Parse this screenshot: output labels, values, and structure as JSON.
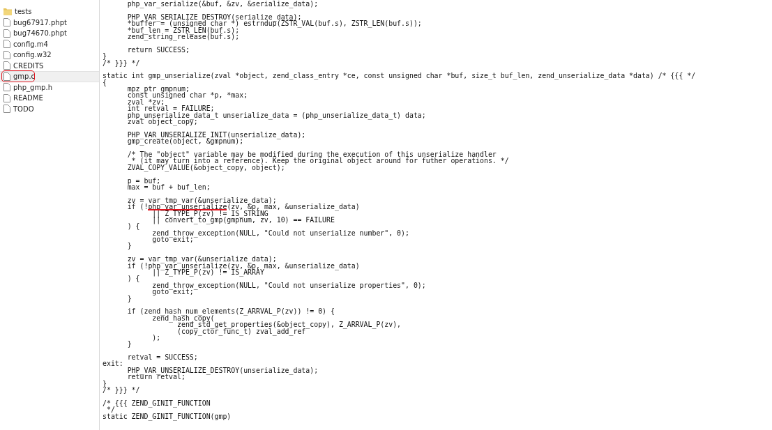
{
  "sidebar": {
    "items": [
      {
        "name": "tests",
        "kind": "folder",
        "selected": false,
        "circled": false
      },
      {
        "name": "bug67917.phpt",
        "kind": "file",
        "selected": false,
        "circled": false
      },
      {
        "name": "bug74670.phpt",
        "kind": "file",
        "selected": false,
        "circled": false
      },
      {
        "name": "config.m4",
        "kind": "file",
        "selected": false,
        "circled": false
      },
      {
        "name": "config.w32",
        "kind": "file",
        "selected": false,
        "circled": false
      },
      {
        "name": "CREDITS",
        "kind": "file",
        "selected": false,
        "circled": false
      },
      {
        "name": "gmp.c",
        "kind": "file",
        "selected": true,
        "circled": true
      },
      {
        "name": "php_gmp.h",
        "kind": "file",
        "selected": false,
        "circled": false
      },
      {
        "name": "README",
        "kind": "file",
        "selected": false,
        "circled": false
      },
      {
        "name": "TODO",
        "kind": "file",
        "selected": false,
        "circled": false
      }
    ]
  },
  "editor": {
    "blocks": [
      {
        "lines": [
          [
            {
              "text": "      php_var_serialize(&buf, &zv, &serialize_data);"
            }
          ]
        ]
      },
      {
        "lines": [
          [
            {
              "text": "      PHP_VAR_SERIALIZE_DESTROY(serialize_data);"
            }
          ],
          [
            {
              "text": "      *buffer = (unsigned char *) estrndup(ZSTR_VAL(buf.s), ZSTR_LEN(buf.s));"
            }
          ],
          [
            {
              "text": "      *buf_len = ZSTR_LEN(buf.s);"
            }
          ],
          [
            {
              "text": "      zend_string_release(buf.s);"
            }
          ]
        ]
      },
      {
        "lines": [
          [
            {
              "text": "      return SUCCESS;"
            }
          ],
          [
            {
              "text": "}"
            }
          ],
          [
            {
              "text": "/* }}} */"
            }
          ]
        ]
      },
      {
        "lines": [
          [
            {
              "text": "static int gmp_unserialize(zval *object, zend_class_entry *ce, const unsigned char *buf, size_t buf_len, zend_unserialize_data *data) /* {{{ */"
            }
          ],
          [
            {
              "text": "{"
            }
          ],
          [
            {
              "text": "      mpz_ptr gmpnum;"
            }
          ],
          [
            {
              "text": "      const unsigned char *p, *max;"
            }
          ],
          [
            {
              "text": "      zval *zv;"
            }
          ],
          [
            {
              "text": "      int retval = FAILURE;"
            }
          ],
          [
            {
              "text": "      php_unserialize_data_t unserialize_data = (php_unserialize_data_t) data;"
            }
          ],
          [
            {
              "text": "      zval object_copy;"
            }
          ]
        ]
      },
      {
        "lines": [
          [
            {
              "text": "      PHP_VAR_UNSERIALIZE_INIT(unserialize_data);"
            }
          ],
          [
            {
              "text": "      gmp_create(object, &gmpnum);"
            }
          ]
        ]
      },
      {
        "lines": [
          [
            {
              "text": "      /* The \"object\" variable may be modified during the execution of this unserialize handler"
            }
          ],
          [
            {
              "text": "       * (it may turn into a reference). Keep the original object around for futher operations. */"
            }
          ],
          [
            {
              "text": "      ZVAL_COPY_VALUE(&object_copy, object);"
            }
          ]
        ]
      },
      {
        "lines": [
          [
            {
              "text": "      p = buf;"
            }
          ],
          [
            {
              "text": "      max = buf + buf_len;"
            }
          ]
        ]
      },
      {
        "lines": [
          [
            {
              "text": "      zv = var_tmp_var(&unserialize_data);"
            }
          ],
          [
            {
              "text": "      if (!"
            },
            {
              "text": "php_var_unserialize",
              "underlined": true
            },
            {
              "text": "(zv, &p, max, &unserialize_data)"
            }
          ],
          [
            {
              "text": "            || Z_TYPE_P(zv) != IS_STRING"
            }
          ],
          [
            {
              "text": "            || convert_to_gmp(gmpnum, zv, 10) == FAILURE"
            }
          ],
          [
            {
              "text": "      ) {"
            }
          ],
          [
            {
              "text": "            zend_throw_exception(NULL, \"Could not unserialize number\", 0);"
            }
          ],
          [
            {
              "text": "            goto exit;"
            }
          ],
          [
            {
              "text": "      }"
            }
          ]
        ]
      },
      {
        "lines": [
          [
            {
              "text": "      zv = var_tmp_var(&unserialize_data);"
            }
          ],
          [
            {
              "text": "      if (!php_var_unserialize(zv, &p, max, &unserialize_data)"
            }
          ],
          [
            {
              "text": "            || Z_TYPE_P(zv) != IS_ARRAY"
            }
          ],
          [
            {
              "text": "      ) {"
            }
          ],
          [
            {
              "text": "            zend_throw_exception(NULL, \"Could not unserialize properties\", 0);"
            }
          ],
          [
            {
              "text": "            goto exit;"
            }
          ],
          [
            {
              "text": "      }"
            }
          ]
        ]
      },
      {
        "lines": [
          [
            {
              "text": "      if (zend_hash_num_elements(Z_ARRVAL_P(zv)) != 0) {"
            }
          ],
          [
            {
              "text": "            zend_hash_copy("
            }
          ],
          [
            {
              "text": "                  zend_std_get_properties(&object_copy), Z_ARRVAL_P(zv),"
            }
          ],
          [
            {
              "text": "                  (copy_ctor_func_t) zval_add_ref"
            }
          ],
          [
            {
              "text": "            );"
            }
          ],
          [
            {
              "text": "      }"
            }
          ]
        ]
      },
      {
        "lines": [
          [
            {
              "text": "      retval = SUCCESS;"
            }
          ],
          [
            {
              "text": "exit:"
            }
          ],
          [
            {
              "text": "      PHP_VAR_UNSERIALIZE_DESTROY(unserialize_data);"
            }
          ],
          [
            {
              "text": "      return retval;"
            }
          ],
          [
            {
              "text": "}"
            }
          ],
          [
            {
              "text": "/* }}} */"
            }
          ]
        ]
      },
      {
        "lines": [
          [
            {
              "text": "/* {{{ ZEND_GINIT_FUNCTION"
            }
          ],
          [
            {
              "text": " */"
            }
          ],
          [
            {
              "text": "static ZEND_GINIT_FUNCTION(gmp)"
            }
          ]
        ]
      }
    ]
  }
}
